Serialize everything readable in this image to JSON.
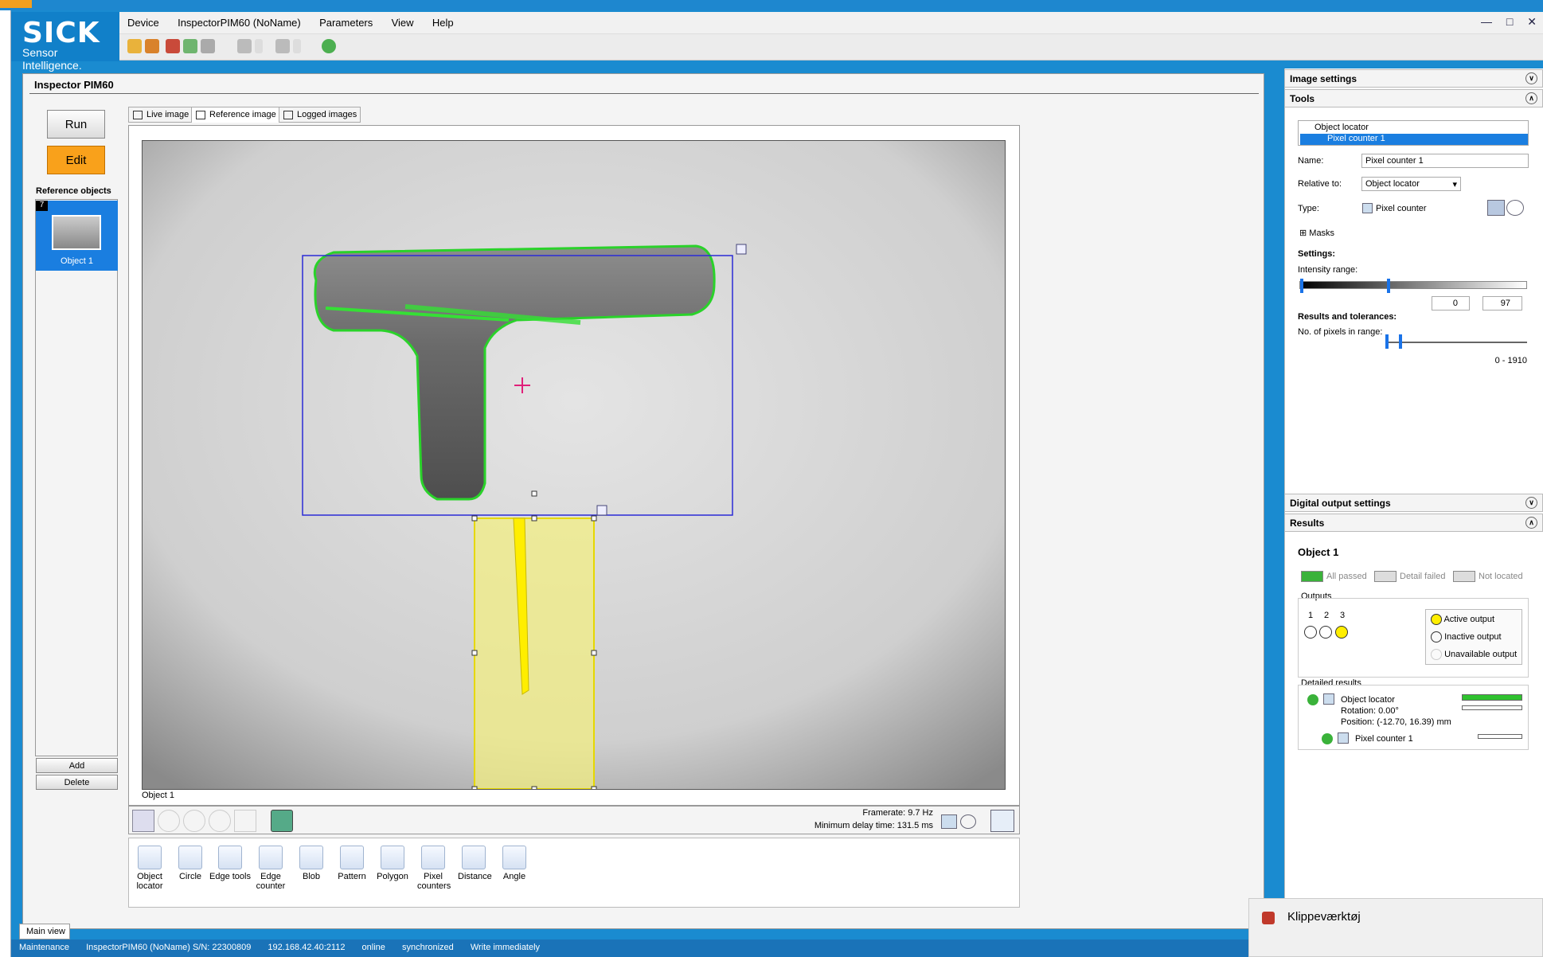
{
  "app": {
    "brand": "SICK",
    "tagline": "Sensor Intelligence.",
    "menu": [
      "Device",
      "InspectorPIM60 (NoName)",
      "Parameters",
      "View",
      "Help"
    ],
    "window_buttons": [
      "minimize",
      "maximize",
      "close"
    ]
  },
  "panel": {
    "title": "Inspector PIM60",
    "run_label": "Run",
    "edit_label": "Edit",
    "reference_objects_label": "Reference objects",
    "object_index": "7",
    "object_name": "Object 1",
    "add_label": "Add",
    "delete_label": "Delete"
  },
  "tabs": [
    {
      "label": "Live image",
      "active": false
    },
    {
      "label": "Reference image",
      "active": true
    },
    {
      "label": "Logged images",
      "active": false
    }
  ],
  "image": {
    "caption": "Object 1",
    "framerate": "Framerate: 9.7 Hz",
    "min_delay": "Minimum delay time: 131.5 ms"
  },
  "image_tools": [
    "select-icon",
    "zoom-in-icon",
    "zoom-out-icon",
    "zoom-fit-icon",
    "pan-hand-icon",
    "database-icon"
  ],
  "tools_palette": [
    {
      "label": "Object locator"
    },
    {
      "label": "Circle"
    },
    {
      "label": "Edge tools"
    },
    {
      "label": "Edge counter"
    },
    {
      "label": "Blob"
    },
    {
      "label": "Pattern"
    },
    {
      "label": "Polygon"
    },
    {
      "label": "Pixel counters"
    },
    {
      "label": "Distance"
    },
    {
      "label": "Angle"
    }
  ],
  "right": {
    "image_settings": "Image settings",
    "tools": "Tools",
    "tree": [
      "Object locator",
      "Pixel counter 1"
    ],
    "name_label": "Name:",
    "name_value": "Pixel counter 1",
    "relative_label": "Relative to:",
    "relative_value": "Object locator",
    "type_label": "Type:",
    "type_value": "Pixel counter",
    "masks": "Masks",
    "settings": "Settings:",
    "intensity_range": "Intensity range:",
    "intensity_min": "0",
    "intensity_max": "97",
    "results_tol": "Results and tolerances:",
    "pixels_in_range": "No. of pixels in range:",
    "pixel_range_text": "0 - 1910",
    "digital_output": "Digital output settings",
    "results": "Results",
    "object_title": "Object 1",
    "legend": [
      "All passed",
      "Detail failed",
      "Not located"
    ],
    "outputs_label": "Outputs",
    "output_numbers": [
      "1",
      "2",
      "3"
    ],
    "output_legend": [
      "Active output",
      "Inactive output",
      "Unavailable output"
    ],
    "detailed_results": "Detailed results",
    "det_object_locator": "Object locator",
    "det_rotation": "Rotation: 0.00°",
    "det_position": "Position: (-12.70, 16.39) mm",
    "det_pixel_counter": "Pixel counter 1",
    "intensity_fraction_min": 0.0,
    "intensity_fraction_max": 0.38,
    "accent": "#1a73e8",
    "active_output_color": "#ffee00"
  },
  "status": {
    "main_view_tab": "Main view",
    "items": [
      "Maintenance",
      "InspectorPIM60 (NoName) S/N: 22300809",
      "192.168.42.40:2112",
      "online",
      "synchronized",
      "Write immediately"
    ]
  },
  "toast": {
    "title": "Klippeværktøj"
  }
}
